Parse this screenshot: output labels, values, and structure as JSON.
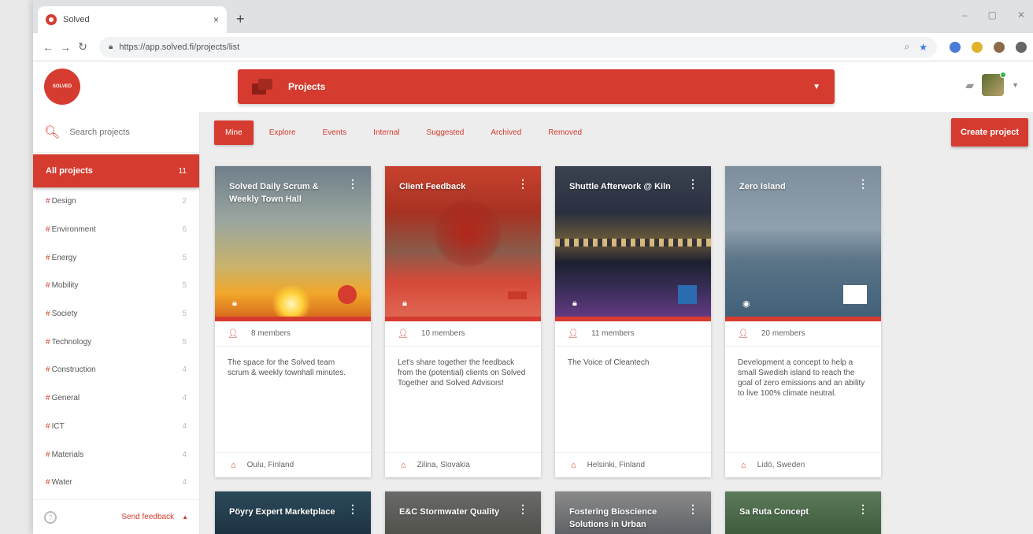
{
  "browser": {
    "tab_title": "Solved",
    "tab_close": "×",
    "new_tab": "+",
    "url": "https://app.solved.fi/projects/list",
    "window_controls": [
      "–",
      "▢",
      "✕"
    ]
  },
  "header": {
    "logo_text": "SOLVED",
    "project_selector_label": "Projects"
  },
  "sidebar": {
    "search_placeholder": "Search projects",
    "all_projects": {
      "label": "All projects",
      "count": "11"
    },
    "categories": [
      {
        "label": "Design",
        "count": "2"
      },
      {
        "label": "Environment",
        "count": "6"
      },
      {
        "label": "Energy",
        "count": "5"
      },
      {
        "label": "Mobility",
        "count": "5"
      },
      {
        "label": "Society",
        "count": "5"
      },
      {
        "label": "Technology",
        "count": "5"
      },
      {
        "label": "Construction",
        "count": "4"
      },
      {
        "label": "General",
        "count": "4"
      },
      {
        "label": "ICT",
        "count": "4"
      },
      {
        "label": "Materials",
        "count": "4"
      },
      {
        "label": "Water",
        "count": "4"
      }
    ],
    "feedback_label": "Send feedback"
  },
  "filters": {
    "tabs": [
      "Mine",
      "Explore",
      "Events",
      "Internal",
      "Suggested",
      "Archived",
      "Removed"
    ],
    "active": "Mine",
    "create_label": "Create project"
  },
  "cards": [
    {
      "title": "Solved Daily Scrum & Weekly Town Hall",
      "members": "8 members",
      "description": "The space for the Solved team scrum & weekly townhall minutes.",
      "location": "Oulu, Finland",
      "image": "sunset"
    },
    {
      "title": "Client Feedback",
      "members": "10 members",
      "description": "Let's share together the feedback from the (potential) clients on Solved Together and Solved Advisors!",
      "location": "Zilina, Slovakia",
      "image": "autumn"
    },
    {
      "title": "Shuttle Afterwork @ Kiln",
      "members": "11 members",
      "description": "The Voice of Cleantech",
      "location": "Helsinki, Finland",
      "image": "night-city"
    },
    {
      "title": "Zero Island",
      "members": "20 members",
      "description": "Development a concept to help a small Swedish island to reach the goal of zero emissions and an ability to live 100% climate neutral.",
      "location": "Lidö, Sweden",
      "image": "sea"
    },
    {
      "title": "Pöyry Expert Marketplace",
      "image": "dark-teal"
    },
    {
      "title": "E&C Stormwater Quality",
      "image": "grey-street"
    },
    {
      "title": "Fostering Bioscience Solutions in Urban",
      "image": "grey-building"
    },
    {
      "title": "Sa Ruta Concept",
      "image": "green-forest"
    }
  ],
  "colors": {
    "accent": "#d63b2f"
  }
}
